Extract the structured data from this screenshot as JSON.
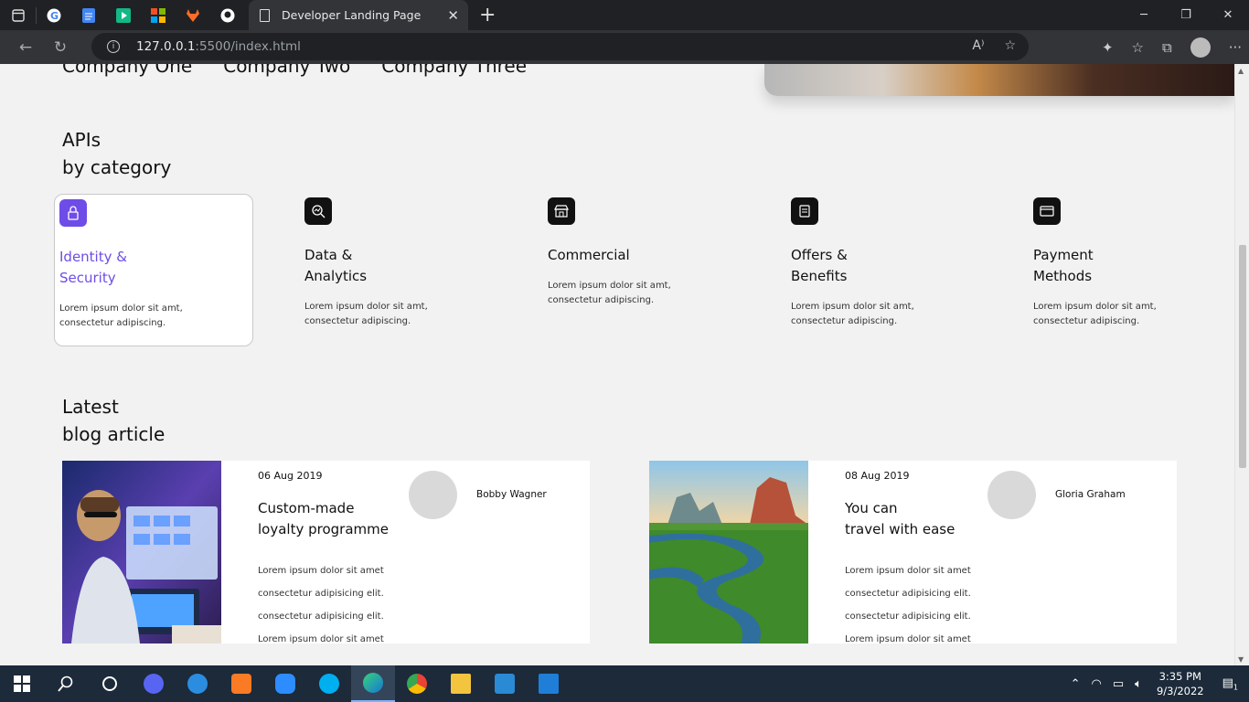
{
  "browser": {
    "tab_title": "Developer Landing Page",
    "url_host": "127.0.0.1",
    "url_rest": ":5500/index.html"
  },
  "companies": [
    "Company One",
    "Company Two",
    "Company Three"
  ],
  "apis": {
    "title_line1": "APIs",
    "title_line2": "by category",
    "cards": [
      {
        "icon": "lock-icon",
        "title1": "Identity &",
        "title2": "Security",
        "desc1": "Lorem ipsum dolor sit amt,",
        "desc2": "consectetur adipiscing."
      },
      {
        "icon": "analytics-icon",
        "title1": "Data &",
        "title2": "Analytics",
        "desc1": "Lorem ipsum dolor sit amt,",
        "desc2": "consectetur adipiscing."
      },
      {
        "icon": "store-icon",
        "title1": "Commercial",
        "title2": "",
        "desc1": "Lorem ipsum dolor sit amt,",
        "desc2": "consectetur adipiscing."
      },
      {
        "icon": "gift-icon",
        "title1": "Offers &",
        "title2": "Benefits",
        "desc1": "Lorem ipsum dolor sit amt,",
        "desc2": "consectetur adipiscing."
      },
      {
        "icon": "card-icon",
        "title1": "Payment",
        "title2": "Methods",
        "desc1": "Lorem ipsum dolor sit amt,",
        "desc2": "consectetur adipiscing."
      }
    ]
  },
  "blog": {
    "title_line1": "Latest",
    "title_line2": "blog article",
    "articles": [
      {
        "date": "06 Aug 2019",
        "title1": "Custom-made",
        "title2": "loyalty programme",
        "author": "Bobby Wagner",
        "lines": [
          "Lorem ipsum dolor sit amet",
          "consectetur adipisicing elit.",
          "consectetur adipisicing elit.",
          "Lorem ipsum dolor sit amet"
        ]
      },
      {
        "date": "08 Aug 2019",
        "title1": "You can",
        "title2": "travel with ease",
        "author": "Gloria Graham",
        "lines": [
          "Lorem ipsum dolor sit amet",
          "consectetur adipisicing elit.",
          "consectetur adipisicing elit.",
          "Lorem ipsum dolor sit amet"
        ]
      }
    ]
  },
  "taskbar": {
    "time": "3:35 PM",
    "date": "9/3/2022",
    "notifications": "1"
  },
  "colors": {
    "accent": "#6e4ce8",
    "page_bg": "#f2f2f2",
    "taskbar": "#1c2a3a"
  }
}
